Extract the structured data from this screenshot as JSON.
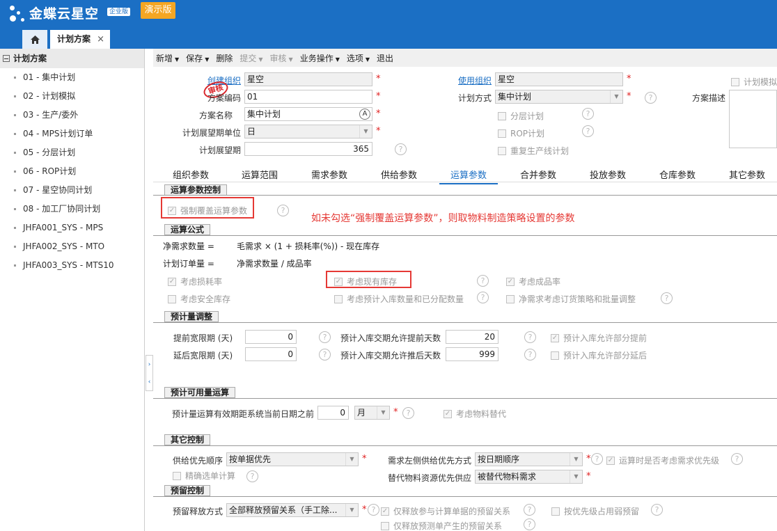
{
  "app": {
    "brand": "金蝶云星空",
    "brand_sub": "企业版",
    "demo": "演示版"
  },
  "tabbar": {
    "active_tab": "计划方案",
    "close": "×"
  },
  "sidebar": {
    "title": "计划方案",
    "items": [
      "01 - 集中计划",
      "02 - 计划模拟",
      "03 - 生产/委外",
      "04 - MPS计划订单",
      "05 - 分层计划",
      "06 - ROP计划",
      "07 - 星空协同计划",
      "08 - 加工厂协同计划",
      "JHFA001_SYS - MPS",
      "JHFA002_SYS - MTO",
      "JHFA003_SYS - MTS10"
    ]
  },
  "toolbar": {
    "new": "新增",
    "save": "保存",
    "delete": "删除",
    "submit": "提交",
    "audit": "审核",
    "business": "业务操作",
    "options": "选项",
    "exit": "退出"
  },
  "header": {
    "create_org_label": "创建组织",
    "create_org": "星空",
    "stamp": "审核",
    "code_label": "方案编码",
    "code": "01",
    "name_label": "方案名称",
    "name": "集中计划",
    "unit_label": "计划展望期单位",
    "unit": "日",
    "period_label": "计划展望期",
    "period": "365",
    "use_org_label": "使用组织",
    "use_org": "星空",
    "method_label": "计划方式",
    "method": "集中计划",
    "layered": "分层计划",
    "rop": "ROP计划",
    "repeat_line": "重复生产线计划",
    "sim": "计划模拟",
    "desc_label": "方案描述"
  },
  "tabs": [
    "组织参数",
    "运算范围",
    "需求参数",
    "供给参数",
    "运算参数",
    "合并参数",
    "投放参数",
    "仓库参数",
    "其它参数"
  ],
  "sec1": {
    "title": "运算参数控制",
    "force": "强制覆盖运算参数"
  },
  "annotation": "如未勾选“强制覆盖运算参数”，则取物料制造策略设置的参数",
  "sec2": {
    "title": "运算公式",
    "f1_label": "净需求数量 =",
    "f1": "毛需求 × (1 + 损耗率(%)) - 现在库存",
    "f2_label": "计划订单量 =",
    "f2": "净需求数量 / 成品率",
    "c1": "考虑损耗率",
    "c2": "考虑现有库存",
    "c3": "考虑成品率",
    "c4": "考虑安全库存",
    "c5": "考虑预计入库数量和已分配数量",
    "c6": "净需求考虑订货策略和批量调整"
  },
  "sec3": {
    "title": "预计量调整",
    "adv_label": "提前宽限期 (天)",
    "adv": "0",
    "delay_label": "延后宽限期 (天)",
    "delay": "0",
    "ahead_label": "预计入库交期允许提前天数",
    "ahead": "20",
    "behind_label": "预计入库交期允许推后天数",
    "behind": "999",
    "allow_ahead": "预计入库允许部分提前",
    "allow_delay": "预计入库允许部分延后"
  },
  "sec4": {
    "title": "预计可用量运算",
    "label": "预计量运算有效期距系统当前日期之前",
    "value": "0",
    "unit": "月",
    "sub": "考虑物料替代"
  },
  "sec5": {
    "title": "其它控制",
    "priority_label": "供给优先顺序",
    "priority": "按单据优先",
    "left_label": "需求左侧供给优先方式",
    "left": "按日期顺序",
    "demand_priority": "运算时是否考虑需求优先级",
    "precise": "精确选单计算",
    "sub_label": "替代物料资源优先供应",
    "sub": "被替代物料需求"
  },
  "sec6": {
    "title": "预留控制",
    "release_label": "预留释放方式",
    "release": "全部释放预留关系（手工除...",
    "only_calc": "仅释放参与计算单据的预留关系",
    "only_forecast": "仅释放预测单产生的预留关系",
    "weak": "按优先级占用弱预留"
  }
}
